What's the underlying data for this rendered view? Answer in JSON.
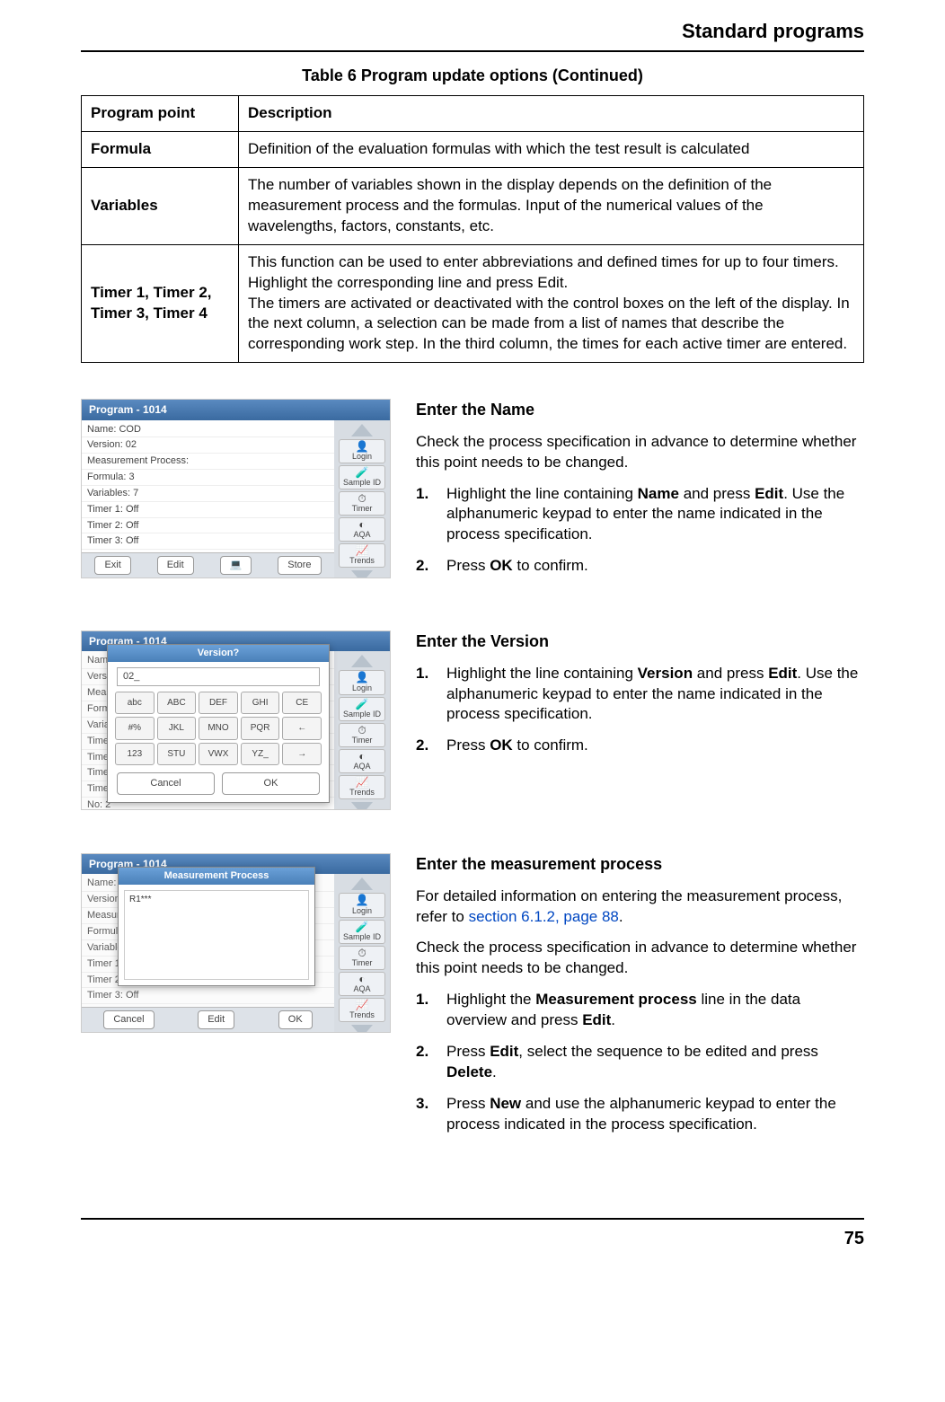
{
  "header": {
    "title": "Standard programs"
  },
  "table": {
    "caption": "Table 6 Program update options (Continued)",
    "head": {
      "c1": "Program point",
      "c2": "Description"
    },
    "rows": [
      {
        "point": "Formula",
        "desc": "Definition of the evaluation formulas with which the test result is calculated"
      },
      {
        "point": "Variables",
        "desc": "The number of variables shown in the display depends on the definition of the measurement process and the formulas. Input of the numerical values of the wavelengths, factors, constants, etc."
      },
      {
        "point": "Timer 1, Timer 2, Timer 3, Timer 4",
        "desc": "This function can be used to enter abbreviations and defined times for up to four timers. Highlight the corresponding line and press Edit.\nThe timers are activated or deactivated with the control boxes on the left of the display. In the next column, a selection can be made from a list of names that describe the corresponding work step. In the third column, the times for each active timer are entered."
      }
    ]
  },
  "thumb_common": {
    "program_title": "Program - 1014",
    "list_items": [
      "Name: COD",
      "Version: 02",
      "Measurement Process:",
      "Formula: 3",
      "Variables: 7",
      "Timer 1: Off",
      "Timer 2: Off",
      "Timer 3: Off",
      "Timer 4: Off",
      "No: 2"
    ],
    "side_items": [
      "Login",
      "Sample ID",
      "Timer",
      "AQA",
      "Trends"
    ],
    "bottom1": {
      "b1": "Exit",
      "b2": "Edit",
      "b3": "Store"
    },
    "keypad": {
      "modal_title": "Version?",
      "field": "02_",
      "keys": [
        "abc",
        "ABC",
        "DEF",
        "GHI",
        "CE",
        "#%",
        "JKL",
        "MNO",
        "PQR",
        "←",
        "123",
        "STU",
        "VWX",
        "YZ_",
        "→"
      ],
      "cancel": "Cancel",
      "ok": "OK"
    },
    "mproc": {
      "modal_title": "Measurement Process",
      "entry": "R1***",
      "bottom": {
        "b1": "Cancel",
        "b2": "Edit",
        "b3": "OK"
      }
    }
  },
  "sections": {
    "name": {
      "title": "Enter the Name",
      "intro": "Check the process specification in advance to determine whether this point needs to be changed.",
      "steps": [
        {
          "pre": "Highlight the line containing ",
          "bold1": "Name",
          "mid": " and press ",
          "bold2": "Edit",
          "post": ". Use the alphanumeric keypad to enter the name indicated in the process specification."
        },
        {
          "pre": "Press ",
          "bold1": "OK",
          "post": " to confirm."
        }
      ]
    },
    "version": {
      "title": "Enter the Version",
      "steps": [
        {
          "pre": "Highlight the line containing ",
          "bold1": "Version",
          "mid": " and press ",
          "bold2": "Edit",
          "post": ". Use the alphanumeric keypad to enter the name indicated in the process specification."
        },
        {
          "pre": "Press ",
          "bold1": "OK",
          "post": " to confirm."
        }
      ]
    },
    "mproc": {
      "title": "Enter the measurement process",
      "p1_pre": "For detailed information on entering the measurement process, refer to ",
      "p1_link": "section 6.1.2, page 88",
      "p1_post": ".",
      "p2": "Check the process specification in advance to determine whether this point needs to be changed.",
      "steps": [
        {
          "pre": "Highlight the ",
          "bold1": "Measurement process",
          "mid": " line in the data overview and press ",
          "bold2": "Edit",
          "post": "."
        },
        {
          "pre": "Press ",
          "bold1": "Edit",
          "mid": ", select the sequence to be edited and press ",
          "bold2": "Delete",
          "post": "."
        },
        {
          "pre": "Press ",
          "bold1": "New",
          "post": " and use the alphanumeric keypad to enter the process indicated in the process specification."
        }
      ]
    }
  },
  "footer": {
    "page": "75"
  }
}
